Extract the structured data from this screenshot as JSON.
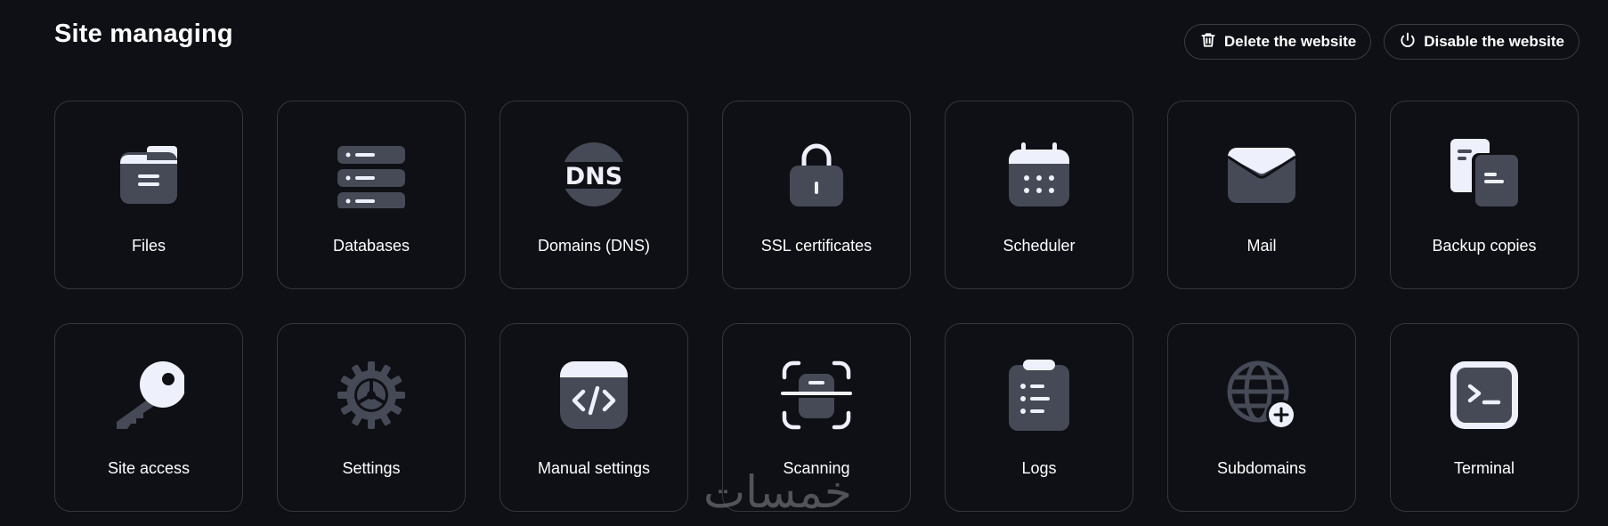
{
  "page": {
    "title": "Site managing"
  },
  "header_actions": {
    "delete_label": "Delete the website",
    "disable_label": "Disable the website"
  },
  "cards": [
    {
      "label": "Files",
      "icon": "folder-icon"
    },
    {
      "label": "Databases",
      "icon": "database-icon"
    },
    {
      "label": "Domains (DNS)",
      "icon": "dns-icon"
    },
    {
      "label": "SSL certificates",
      "icon": "lock-icon"
    },
    {
      "label": "Scheduler",
      "icon": "calendar-icon"
    },
    {
      "label": "Mail",
      "icon": "mail-icon"
    },
    {
      "label": "Backup copies",
      "icon": "copy-icon"
    },
    {
      "label": "Site access",
      "icon": "key-icon"
    },
    {
      "label": "Settings",
      "icon": "gear-icon"
    },
    {
      "label": "Manual settings",
      "icon": "code-icon"
    },
    {
      "label": "Scanning",
      "icon": "scan-icon"
    },
    {
      "label": "Logs",
      "icon": "clipboard-list-icon"
    },
    {
      "label": "Subdomains",
      "icon": "globe-plus-icon"
    },
    {
      "label": "Terminal",
      "icon": "terminal-icon"
    }
  ],
  "watermark": "خمسات",
  "colors": {
    "background": "#0f1015",
    "card_border": "#34363e",
    "icon_dark": "#454a56",
    "icon_light": "#eef0fb"
  }
}
